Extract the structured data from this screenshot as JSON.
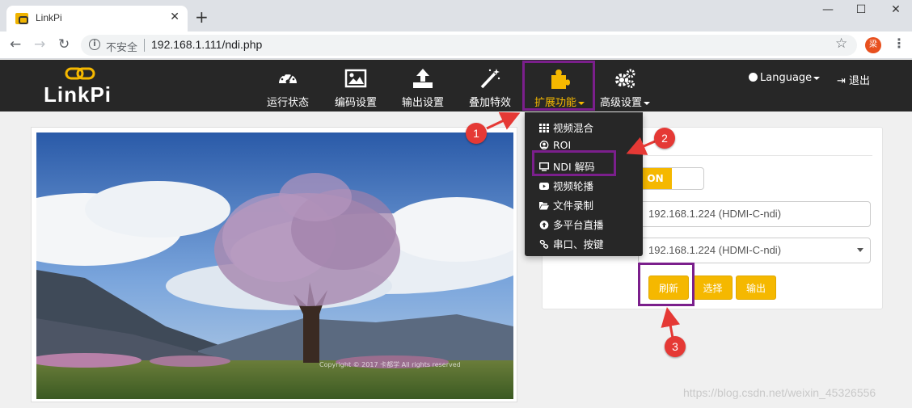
{
  "browser": {
    "tab_title": "LinkPi",
    "new_tab": "+",
    "insecure_label": "不安全",
    "url": "192.168.1.111/ndi.php",
    "profile_initial": "梁"
  },
  "app": {
    "logo": "LinkPi",
    "nav": [
      {
        "label": "运行状态",
        "icon": "dashboard-icon"
      },
      {
        "label": "编码设置",
        "icon": "picture-icon"
      },
      {
        "label": "输出设置",
        "icon": "upload-icon"
      },
      {
        "label": "叠加特效",
        "icon": "magic-wand-icon"
      },
      {
        "label": "扩展功能",
        "icon": "puzzle-icon"
      },
      {
        "label": "高级设置",
        "icon": "gears-icon"
      }
    ],
    "language": "Language",
    "logout": "退出"
  },
  "dropdown": {
    "items": [
      {
        "label": "视频混合",
        "icon": "grid-icon"
      },
      {
        "label": "ROI",
        "icon": "user-circle-icon"
      },
      {
        "label": "NDI 解码",
        "icon": "monitor-icon"
      },
      {
        "label": "视频轮播",
        "icon": "youtube-play-icon"
      },
      {
        "label": "文件录制",
        "icon": "folder-open-icon"
      },
      {
        "label": "多平台直播",
        "icon": "arrow-circle-up-icon"
      },
      {
        "label": "串口、按键",
        "icon": "link-icon"
      }
    ]
  },
  "form": {
    "toggle_on": "ON",
    "source_value": "192.168.1.224 (HDMI-C-ndi)",
    "select_value": "192.168.1.224 (HDMI-C-ndi)",
    "buttons": {
      "refresh": "刷新",
      "select": "选择",
      "output": "输出"
    }
  },
  "photo": {
    "copyright": "Copyright © 2017 卡都学 All rights reserved"
  },
  "callouts": [
    "1",
    "2",
    "3"
  ],
  "watermark": "https://blog.csdn.net/weixin_45326556",
  "colors": {
    "accent": "#f5b800",
    "navbar": "#272727",
    "highlight": "#7b1f8c",
    "callout": "#e53935"
  }
}
